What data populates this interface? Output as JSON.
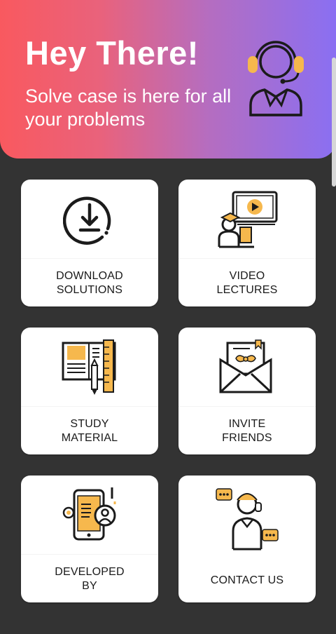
{
  "hero": {
    "title": "Hey There!",
    "subtitle": "Solve case is here for all your problems",
    "icon": "support-agent-icon"
  },
  "colors": {
    "background": "#333333",
    "gradient_start": "#f9595f",
    "gradient_end": "#8a6ff2",
    "accent": "#f6b84d"
  },
  "cards": [
    {
      "label": "DOWNLOAD\nSOLUTIONS",
      "icon": "download-icon"
    },
    {
      "label": "VIDEO\nLECTURES",
      "icon": "video-lecture-icon"
    },
    {
      "label": "STUDY\nMATERIAL",
      "icon": "book-pencil-icon"
    },
    {
      "label": "INVITE\nFRIENDS",
      "icon": "invite-envelope-icon"
    },
    {
      "label": "DEVELOPED\nBY",
      "icon": "developer-phone-icon"
    },
    {
      "label": "CONTACT US",
      "icon": "contact-person-icon"
    }
  ]
}
